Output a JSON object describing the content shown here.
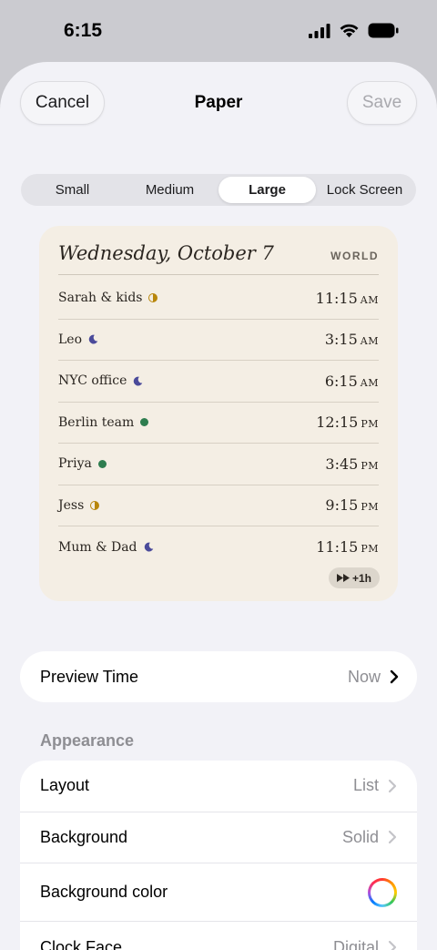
{
  "status_bar": {
    "time": "6:15"
  },
  "nav": {
    "cancel_label": "Cancel",
    "title": "Paper",
    "save_label": "Save"
  },
  "size_tabs": [
    "Small",
    "Medium",
    "Large",
    "Lock Screen"
  ],
  "selected_tab": "Large",
  "widget": {
    "date": "Wednesday, October 7",
    "label": "WORLD",
    "rows": [
      {
        "name": "Sarah & kids",
        "icon": "half-sun-icon",
        "time": "11:15",
        "ampm": "AM"
      },
      {
        "name": "Leo",
        "icon": "moon-icon",
        "time": "3:15",
        "ampm": "AM"
      },
      {
        "name": "NYC office",
        "icon": "moon-icon",
        "time": "6:15",
        "ampm": "AM"
      },
      {
        "name": "Berlin team",
        "icon": "green-dot-icon",
        "time": "12:15",
        "ampm": "PM"
      },
      {
        "name": "Priya",
        "icon": "green-dot-icon",
        "time": "3:45",
        "ampm": "PM"
      },
      {
        "name": "Jess",
        "icon": "half-sun-icon",
        "time": "9:15",
        "ampm": "PM"
      },
      {
        "name": "Mum & Dad",
        "icon": "moon-icon",
        "time": "11:15",
        "ampm": "PM"
      }
    ],
    "badge": "+1h"
  },
  "preview_time": {
    "label": "Preview Time",
    "value": "Now"
  },
  "appearance": {
    "header": "Appearance",
    "rows": [
      {
        "label": "Layout",
        "value": "List"
      },
      {
        "label": "Background",
        "value": "Solid"
      },
      {
        "label": "Background color",
        "value": ""
      },
      {
        "label": "Clock Face",
        "value": "Digital"
      }
    ]
  },
  "colors": {
    "widget_bg": "#f4eee4",
    "sheet_bg": "#f2f2f7",
    "available_dot": "#2e7d4f",
    "day_icon": "#b8860b",
    "night_icon": "#4a4a9a"
  }
}
